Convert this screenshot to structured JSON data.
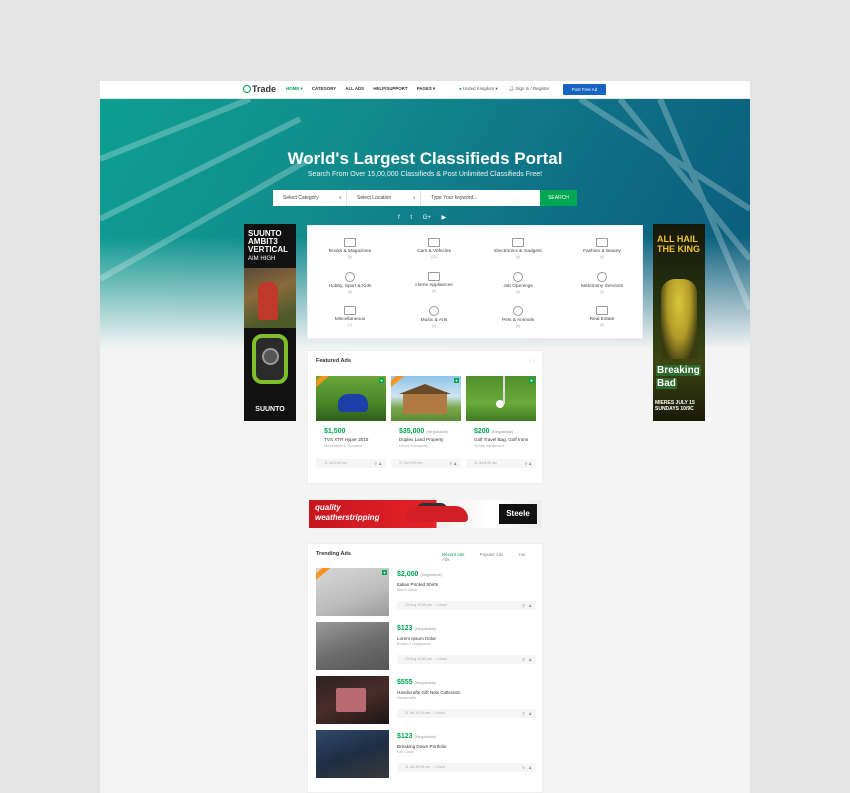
{
  "nav": {
    "logo": "Trade",
    "menu": [
      "HOME ▾",
      "CATEGORY",
      "ALL ADS",
      "HELP/SUPPORT",
      "PAGES ▾"
    ],
    "country": "United Kingdom ▾",
    "signin": "Sign In / Register",
    "post_ad": "Post Free Ad"
  },
  "hero": {
    "title": "World's Largest Classifieds Portal",
    "subtitle": "Search From Over 15,00,000 Classifieds & Post Unlimited Classifieds Free!",
    "select_category": "Select Category",
    "select_location": "Select Location",
    "keyword_placeholder": "Type Your keyword...",
    "search_button": "SEARCH",
    "social": [
      "f",
      "t",
      "G+",
      "▶"
    ]
  },
  "ad_left": {
    "headline": "SUUNTO AMBIT3 VERTICAL",
    "tagline": "AIM HIGH",
    "brand": "SUUNTO"
  },
  "ad_right": {
    "headline": "ALL HAIL THE KING",
    "title1": "Breaking",
    "title2": "Bad",
    "date": "MIERES JULY 15 SUNDAYS 10/9C"
  },
  "categories": [
    {
      "name": "Books & Magazines",
      "count": "(8)"
    },
    {
      "name": "Cars & Vehicles",
      "count": "(12)"
    },
    {
      "name": "Electronics & Gadgets",
      "count": "(6)"
    },
    {
      "name": "Fashion & Beauty",
      "count": "(4)"
    },
    {
      "name": "Hobby, Sport & Kids",
      "count": "(5)"
    },
    {
      "name": "Home Appliances",
      "count": "(9)"
    },
    {
      "name": "Job Openings",
      "count": "(3)"
    },
    {
      "name": "Matrimony Services",
      "count": "(2)"
    },
    {
      "name": "Miscellaneous",
      "count": "(7)"
    },
    {
      "name": "Music & Arts",
      "count": "(4)"
    },
    {
      "name": "Pets & Animals",
      "count": "(6)"
    },
    {
      "name": "Real Estate",
      "count": "(5)"
    }
  ],
  "featured": {
    "title": "Featured Ads",
    "arrows": "‹  ›",
    "items": [
      {
        "price": "$1,500",
        "note": "",
        "title": "TVS XTR Hyper 2015",
        "sub": "Motorbikes & Scooters",
        "date": "11 Jul 8:45 am"
      },
      {
        "price": "$35,000",
        "note": "(Negotiable)",
        "title": "Duplex Land Property",
        "sub": "Lands & property",
        "date": "17 Jul 9:00 am"
      },
      {
        "price": "$200",
        "note": "(Negotiable)",
        "title": "Golf Travel Bag, Golf Irons",
        "sub": "Sports equipment",
        "date": "11 Jul 8:45 am"
      }
    ]
  },
  "strip": {
    "slogan1": "quality",
    "slogan2": "weatherstripping",
    "brand": "Steele"
  },
  "trending": {
    "title": "Trending Ads",
    "tabs": [
      "Recent Ads",
      "Popular Ads",
      "Hot Ads"
    ],
    "items": [
      {
        "price": "$2,000",
        "note": "(Negotiable)",
        "title": "Italian Printed Shirts",
        "sub": "Men's Wear",
        "date": "23 Aug 12:30 pm",
        "tag": "Used"
      },
      {
        "price": "$123",
        "note": "(Negotiable)",
        "title": "Lorem Ipsum Dolar",
        "sub": "Books & Magazines",
        "date": "23 Aug 12:30 pm",
        "tag": "Used"
      },
      {
        "price": "$555",
        "note": "(Negotiable)",
        "title": "Handicrafts Gift New Collection",
        "sub": "Handicrafts",
        "date": "11 Jul 10:08 am",
        "tag": "Used"
      },
      {
        "price": "$123",
        "note": "(Negotiable)",
        "title": "Breaking Down Portfolio",
        "sub": "Gift Cards",
        "date": "11 Jul 10:08 am",
        "tag": "Used"
      }
    ]
  }
}
